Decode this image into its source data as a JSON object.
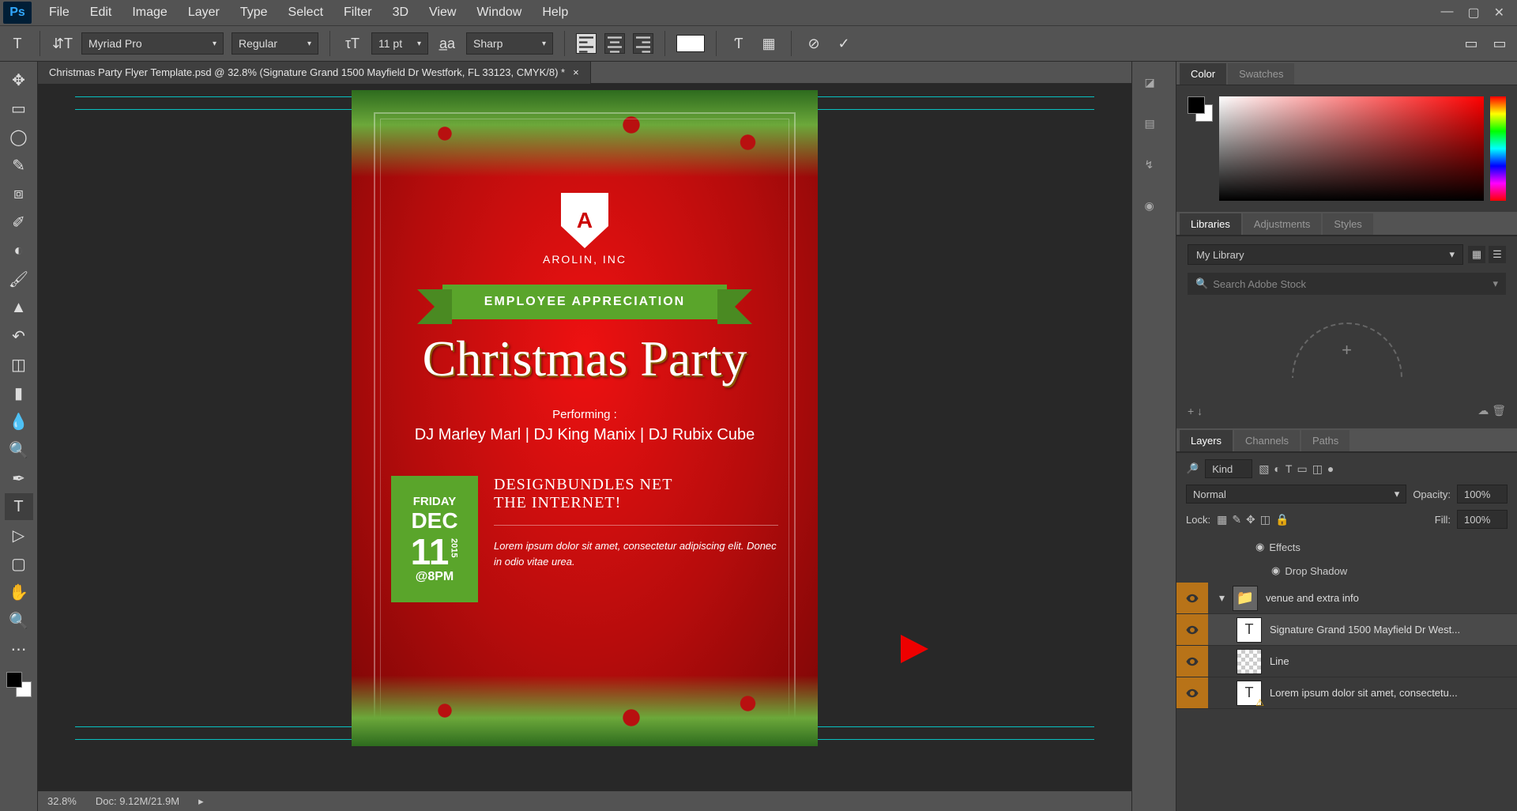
{
  "menus": [
    "File",
    "Edit",
    "Image",
    "Layer",
    "Type",
    "Select",
    "Filter",
    "3D",
    "View",
    "Window",
    "Help"
  ],
  "options": {
    "font": "Myriad Pro",
    "style": "Regular",
    "size": "11 pt",
    "aa": "Sharp"
  },
  "doc_tab": "Christmas Party Flyer Template.psd @ 32.8% (Signature Grand 1500 Mayfield Dr Westfork, FL 33123, CMYK/8) *",
  "status": {
    "zoom": "32.8%",
    "docinfo": "Doc: 9.12M/21.9M"
  },
  "flyer": {
    "company": "AROLIN, INC",
    "banner": "EMPLOYEE APPRECIATION",
    "title": "Christmas Party",
    "performing_label": "Performing :",
    "performing": "DJ Marley Marl | DJ King Manix | DJ Rubix Cube",
    "day": "FRIDAY",
    "month": "DEC",
    "date": "11",
    "year": "2015",
    "time": "@8PM",
    "hand1": "DESIGNBUNDLES NET",
    "hand2": "THE INTERNET!",
    "lorem": "Lorem ipsum dolor sit amet, consectetur adipiscing elit. Donec in odio vitae urea."
  },
  "panel_tabs": {
    "color": "Color",
    "swatches": "Swatches",
    "libraries": "Libraries",
    "adjustments": "Adjustments",
    "styles": "Styles",
    "layers": "Layers",
    "channels": "Channels",
    "paths": "Paths"
  },
  "library": {
    "name": "My Library",
    "search": "Search Adobe Stock"
  },
  "layer_ops": {
    "kind": "Kind",
    "blend": "Normal",
    "opacity_label": "Opacity:",
    "opacity": "100%",
    "lock": "Lock:",
    "fill_label": "Fill:",
    "fill": "100%"
  },
  "layers": {
    "effects": "Effects",
    "dropshadow": "Drop Shadow",
    "group": "venue and extra info",
    "text1": "Signature Grand 1500 Mayfield Dr West...",
    "line": "Line",
    "text2": "Lorem ipsum dolor sit amet, consectetu..."
  }
}
